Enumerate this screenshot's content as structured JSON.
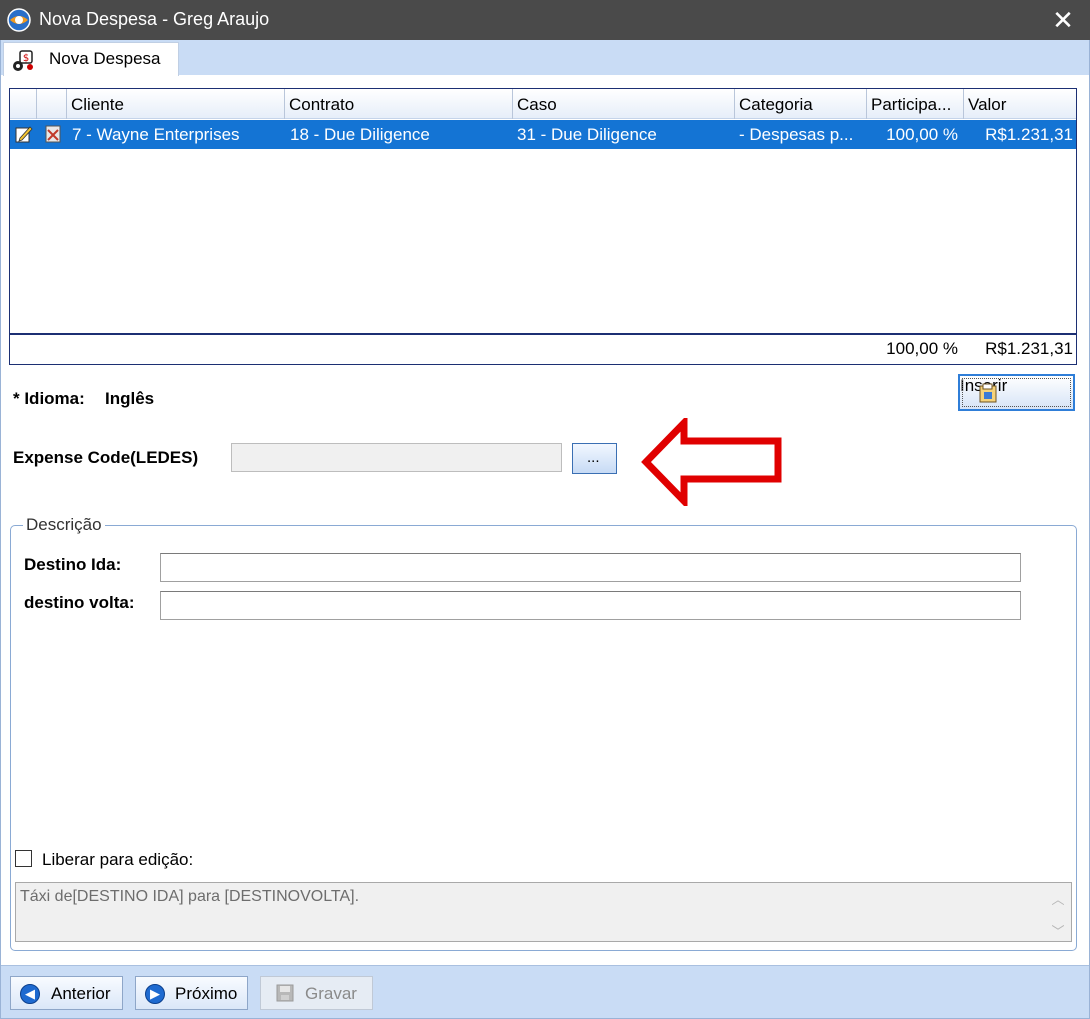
{
  "window": {
    "title": "Nova Despesa - Greg Araujo",
    "close_glyph": "✕",
    "icon": "app-globe-icon"
  },
  "tab": {
    "label": "Nova Despesa",
    "icon": "expense-icon"
  },
  "grid": {
    "columns": [
      "Cliente",
      "Contrato",
      "Caso",
      "Categoria",
      "Participa...",
      "Valor"
    ],
    "rows": [
      {
        "cliente": "7 - Wayne Enterprises",
        "contrato": "18 - Due Diligence",
        "caso": "31 - Due Diligence",
        "categoria": "- Despesas p...",
        "participacao": "100,00 %",
        "valor": "R$1.231,31"
      }
    ],
    "footer": {
      "participacao_total": "100,00 %",
      "valor_total": "R$1.231,31"
    },
    "selected_row_color": "#1474d4"
  },
  "form": {
    "idioma_label": "* Idioma:",
    "idioma_value": "Inglês",
    "inserir_label": "Inserir",
    "expense_code_label": "Expense Code(LEDES)",
    "expense_code_value": "",
    "browse_button_label": "...",
    "descricao_group_title": "Descrição",
    "destino_ida_label": "Destino Ida:",
    "destino_ida_value": "",
    "destino_volta_label": "destino volta:",
    "destino_volta_value": "",
    "liberar_label": "Liberar para edição:",
    "liberar_checked": false,
    "description_text": "Táxi de[DESTINO IDA] para [DESTINOVOLTA]."
  },
  "bottom_bar": {
    "anterior_label": "Anterior",
    "proximo_label": "Próximo",
    "gravar_label": "Gravar"
  },
  "annotation": {
    "arrow_color": "#e00000"
  }
}
